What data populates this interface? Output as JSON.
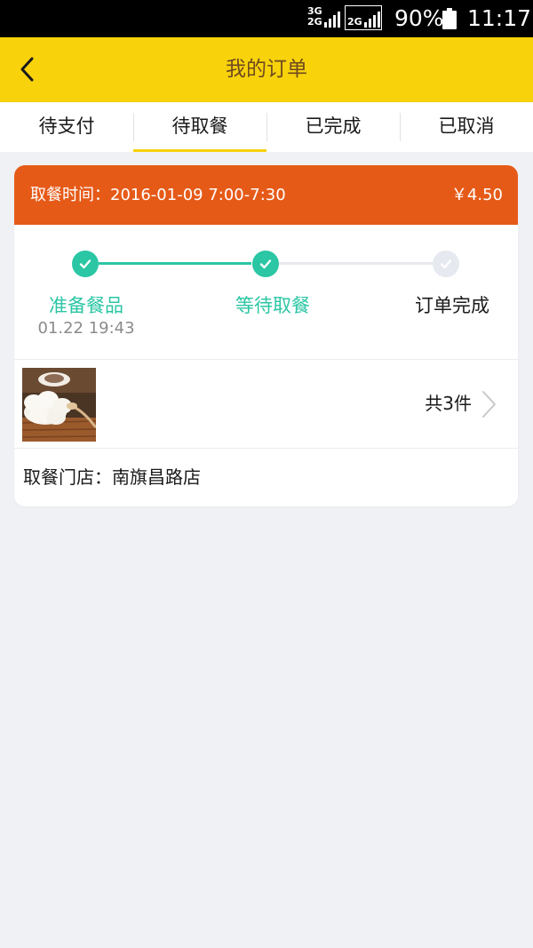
{
  "status_bar": {
    "network_3g": "3G",
    "network_2g_a": "2G",
    "network_2g_b": "2G",
    "battery": "90%",
    "time": "11:17"
  },
  "header": {
    "title": "我的订单",
    "back_icon": "chevron-left-icon"
  },
  "tabs": [
    {
      "label": "待支付"
    },
    {
      "label": "待取餐"
    },
    {
      "label": "已完成"
    },
    {
      "label": "已取消"
    }
  ],
  "order": {
    "pickup_time": "取餐时间：2016-01-09 7:00-7:30",
    "price": "￥4.50",
    "steps": [
      {
        "label": "准备餐品",
        "time": "01.22 19:43"
      },
      {
        "label": "等待取餐"
      },
      {
        "label": "订单完成"
      }
    ],
    "item_count": "共3件",
    "store": "取餐门店：南旗昌路店"
  },
  "colors": {
    "brand_yellow": "#f8d20b",
    "order_header_orange": "#e65a18",
    "progress_green": "#2bc6a4",
    "page_bg": "#f0f1f5"
  }
}
